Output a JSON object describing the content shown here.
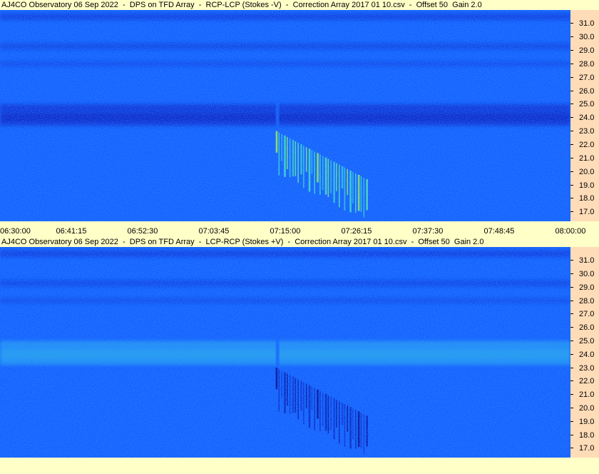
{
  "panels": [
    {
      "title": "AJ4CO Observatory 06 Sep 2022  -  DPS on TFD Array  -  RCP-LCP (Stokes -V)  -  Correction Array 2017 01 10.csv  -  Offset 50  Gain 2.0"
    },
    {
      "title": "AJ4CO Observatory 06 Sep 2022  -  DPS on TFD Array  -  LCP-RCP (Stokes +V)  -  Correction Array 2017 01 10.csv  -  Offset 50  Gain 2.0"
    }
  ],
  "chart_data": [
    {
      "type": "heatmap",
      "title": "AJ4CO Observatory 06 Sep 2022  -  DPS on TFD Array  -  RCP-LCP (Stokes -V)  -  Correction Array 2017 01 10.csv  -  Offset 50  Gain 2.0",
      "xlabel": "",
      "ylabel": "",
      "x_ticks": [
        "06:30:00",
        "06:41:15",
        "06:52:30",
        "07:03:45",
        "07:15:00",
        "07:26:15",
        "07:37:30",
        "07:48:45",
        "08:00:00"
      ],
      "y_ticks": [
        "31.0",
        "30.0",
        "29.0",
        "28.0",
        "27.0",
        "26.0",
        "25.0",
        "24.0",
        "23.0",
        "22.0",
        "21.0",
        "20.0",
        "19.0",
        "18.0",
        "17.0"
      ],
      "xlim": [
        "06:30:00",
        "08:00:00"
      ],
      "ylim": [
        16.3,
        32.0
      ],
      "colormap": [
        "#00007a",
        "#0a2ad0",
        "#1560ff",
        "#2aa8f0",
        "#40e0c8",
        "#b8f040",
        "#f8e020"
      ],
      "background_level": 0.33,
      "bands": [
        {
          "freq_center": 24.0,
          "freq_width": 0.6,
          "level": 0.06
        },
        {
          "freq_center": 24.2,
          "freq_width": 1.6,
          "level": 0.18
        },
        {
          "freq_center": 31.5,
          "freq_width": 0.5,
          "level": 0.22
        },
        {
          "freq_center": 29.3,
          "freq_width": 0.5,
          "level": 0.24
        },
        {
          "freq_center": 28.0,
          "freq_width": 0.4,
          "level": 0.26
        }
      ],
      "burst": {
        "start_time": "07:13:30",
        "end_time": "07:27:45",
        "freq_high": 23.0,
        "freq_low": 16.5,
        "level": 0.82,
        "polarity": "bright"
      },
      "gap_time": "07:13:30"
    },
    {
      "type": "heatmap",
      "title": "AJ4CO Observatory 06 Sep 2022  -  DPS on TFD Array  -  LCP-RCP (Stokes +V)  -  Correction Array 2017 01 10.csv  -  Offset 50  Gain 2.0",
      "xlabel": "",
      "ylabel": "",
      "x_ticks": [
        "06:30:00",
        "06:41:15",
        "06:52:30",
        "07:03:45",
        "07:15:00",
        "07:26:15",
        "07:37:30",
        "07:48:45",
        "08:00:00"
      ],
      "y_ticks": [
        "31.0",
        "30.0",
        "29.0",
        "28.0",
        "27.0",
        "26.0",
        "25.0",
        "24.0",
        "23.0",
        "22.0",
        "21.0",
        "20.0",
        "19.0",
        "18.0",
        "17.0"
      ],
      "xlim": [
        "06:30:00",
        "08:00:00"
      ],
      "ylim": [
        16.3,
        32.0
      ],
      "colormap": [
        "#00007a",
        "#0a2ad0",
        "#1560ff",
        "#2aa8f0",
        "#40e0c8",
        "#b8f040",
        "#f8e020"
      ],
      "background_level": 0.33,
      "bands": [
        {
          "freq_center": 24.0,
          "freq_width": 0.7,
          "level": 0.62
        },
        {
          "freq_center": 24.1,
          "freq_width": 1.8,
          "level": 0.46
        },
        {
          "freq_center": 31.5,
          "freq_width": 0.5,
          "level": 0.22
        },
        {
          "freq_center": 29.3,
          "freq_width": 0.5,
          "level": 0.24
        },
        {
          "freq_center": 28.0,
          "freq_width": 0.4,
          "level": 0.26
        }
      ],
      "burst": {
        "start_time": "07:13:30",
        "end_time": "07:27:45",
        "freq_high": 23.0,
        "freq_low": 16.5,
        "level": 0.02,
        "polarity": "dark"
      },
      "gap_time": "07:13:30"
    }
  ]
}
